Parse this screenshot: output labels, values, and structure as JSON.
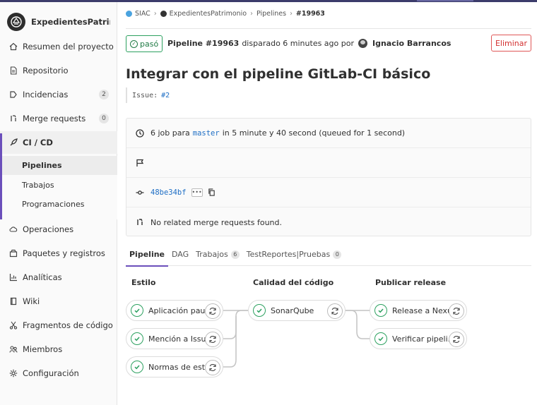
{
  "project": {
    "name": "ExpedientesPatrim..."
  },
  "sidebar": {
    "items": [
      {
        "label": "Resumen del proyecto",
        "icon": "home-icon"
      },
      {
        "label": "Repositorio",
        "icon": "file-icon"
      },
      {
        "label": "Incidencias",
        "icon": "issues-icon",
        "count": "2"
      },
      {
        "label": "Merge requests",
        "icon": "merge-request-icon",
        "count": "0"
      },
      {
        "label": "CI / CD",
        "icon": "rocket-icon"
      },
      {
        "label": "Operaciones",
        "icon": "cloud-icon"
      },
      {
        "label": "Paquetes y registros",
        "icon": "package-icon"
      },
      {
        "label": "Analíticas",
        "icon": "chart-icon"
      },
      {
        "label": "Wiki",
        "icon": "book-icon"
      },
      {
        "label": "Fragmentos de código",
        "icon": "scissors-icon"
      },
      {
        "label": "Miembros",
        "icon": "users-icon"
      },
      {
        "label": "Configuración",
        "icon": "settings-icon"
      }
    ],
    "cicd_sub": [
      "Pipelines",
      "Trabajos",
      "Programaciones"
    ]
  },
  "breadcrumb": [
    "SIAC",
    "ExpedientesPatrimonio",
    "Pipelines",
    "#19963"
  ],
  "pipeline": {
    "status": "pasó",
    "id_label": "Pipeline #19963",
    "triggered": "disparado 6 minutes ago por",
    "user": "Ignacio Barrancos",
    "delete_label": "Eliminar",
    "title": "Integrar con el pipeline GitLab-CI básico",
    "issue_prefix": "Issue:",
    "issue_link": "#2"
  },
  "info": {
    "jobs_pre": "6 job para",
    "branch": "master",
    "jobs_post": "in 5 minute y 40 second (queued for 1 second)",
    "commit": "48be34bf",
    "mr_text": "No related merge requests found."
  },
  "tabs": [
    {
      "label": "Pipeline",
      "count": null
    },
    {
      "label": "DAG",
      "count": null
    },
    {
      "label": "Trabajos",
      "count": "6"
    },
    {
      "label": "TestReportes|Pruebas",
      "count": "0"
    }
  ],
  "stages": [
    {
      "name": "Estilo",
      "jobs": [
        "Aplicación paut...",
        "Mención a Issues",
        "Normas de estilo"
      ]
    },
    {
      "name": "Calidad del código",
      "jobs": [
        "SonarQube"
      ]
    },
    {
      "name": "Publicar release",
      "jobs": [
        "Release a Nexus",
        "Verificar pipeli..."
      ]
    }
  ],
  "colors": {
    "success": "#2da160",
    "accent": "#6b4fbb",
    "danger": "#d22f2f",
    "link": "#1f6fc5"
  }
}
